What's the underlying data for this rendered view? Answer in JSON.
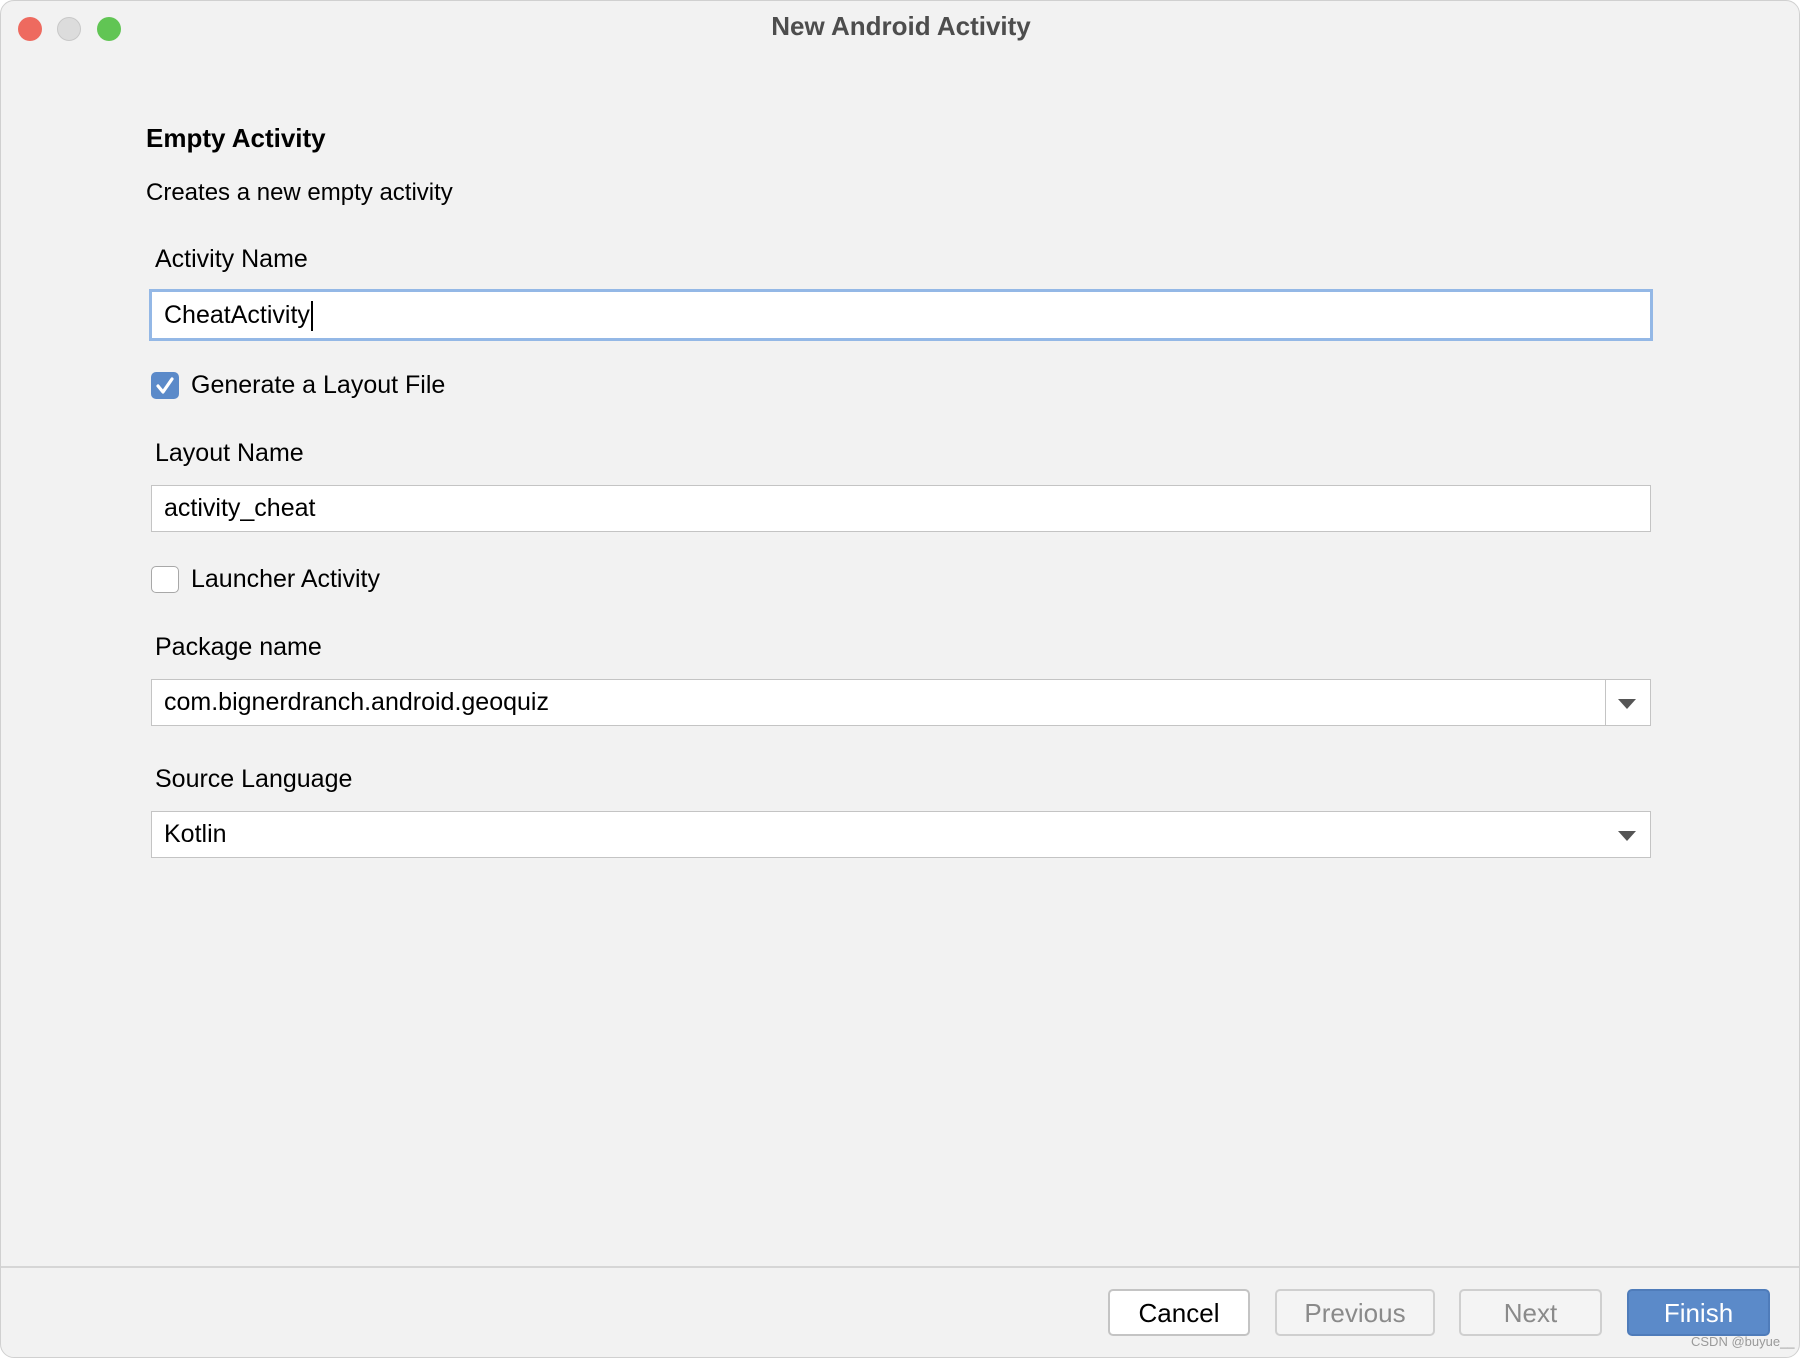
{
  "window": {
    "title": "New Android Activity",
    "controls": {
      "close": "#ee6a5f",
      "minimize": "#dcdcdc",
      "zoom": "#61c554"
    }
  },
  "header": {
    "title": "Empty Activity",
    "description": "Creates a new empty activity"
  },
  "form": {
    "activity_name": {
      "label": "Activity Name",
      "value": "CheatActivity"
    },
    "generate_layout": {
      "label": "Generate a Layout File",
      "checked": true
    },
    "layout_name": {
      "label": "Layout Name",
      "value": "activity_cheat"
    },
    "launcher_activity": {
      "label": "Launcher Activity",
      "checked": false
    },
    "package_name": {
      "label": "Package name",
      "value": "com.bignerdranch.android.geoquiz"
    },
    "source_language": {
      "label": "Source Language",
      "value": "Kotlin"
    }
  },
  "footer": {
    "cancel": "Cancel",
    "previous": "Previous",
    "next": "Next",
    "finish": "Finish"
  },
  "accent": "#5b8ac9",
  "watermark": "CSDN @buyue__"
}
